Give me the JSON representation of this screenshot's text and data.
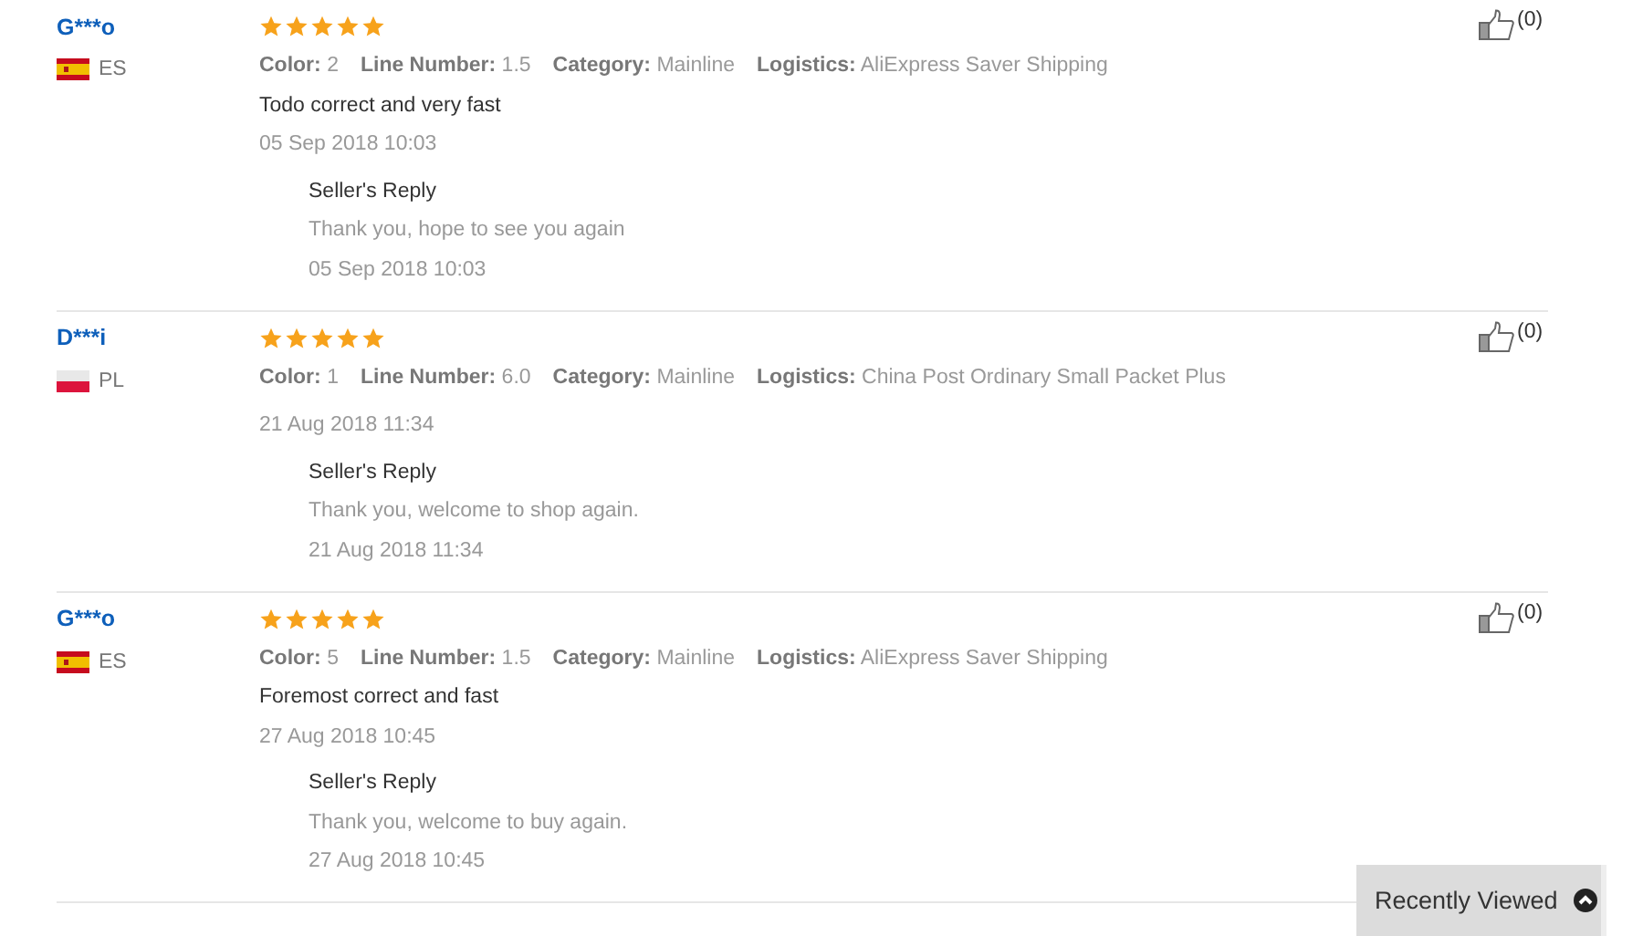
{
  "reviews": [
    {
      "name": "G***o",
      "country": "ES",
      "kind": "spain",
      "stars": 5,
      "attributes": [
        {
          "label": "Color:",
          "value": "2"
        },
        {
          "label": "Line Number:",
          "value": "1.5"
        },
        {
          "label": "Category:",
          "value": "Mainline"
        },
        {
          "label": "Logistics:",
          "value": "AliExpress Saver Shipping"
        }
      ],
      "comment": "Todo correct and very fast",
      "date": "05 Sep 2018 10:03",
      "reply": {
        "title": "Seller's Reply",
        "text": "Thank you, hope to see you again",
        "date": "05 Sep 2018 10:03"
      },
      "likes": "(0)"
    },
    {
      "name": "D***i",
      "country": "PL",
      "kind": "poland",
      "stars": 5,
      "attributes": [
        {
          "label": "Color:",
          "value": "1"
        },
        {
          "label": "Line Number:",
          "value": "6.0"
        },
        {
          "label": "Category:",
          "value": "Mainline"
        },
        {
          "label": "Logistics:",
          "value": "China Post Ordinary Small Packet Plus"
        }
      ],
      "date": "21 Aug 2018 11:34",
      "reply": {
        "title": "Seller's Reply",
        "text": "Thank you, welcome to shop again.",
        "date": "21 Aug 2018 11:34"
      },
      "likes": "(0)"
    },
    {
      "name": "G***o",
      "country": "ES",
      "kind": "spain",
      "stars": 5,
      "attributes": [
        {
          "label": "Color:",
          "value": "5"
        },
        {
          "label": "Line Number:",
          "value": "1.5"
        },
        {
          "label": "Category:",
          "value": "Mainline"
        },
        {
          "label": "Logistics:",
          "value": "AliExpress Saver Shipping"
        }
      ],
      "comment": "Foremost correct and fast",
      "date": "27 Aug 2018 10:45",
      "reply": {
        "title": "Seller's Reply",
        "text": "Thank you, welcome to buy again.",
        "date": "27 Aug 2018 10:45"
      },
      "likes": "(0)"
    }
  ],
  "recently_viewed": {
    "label": "Recently Viewed"
  }
}
